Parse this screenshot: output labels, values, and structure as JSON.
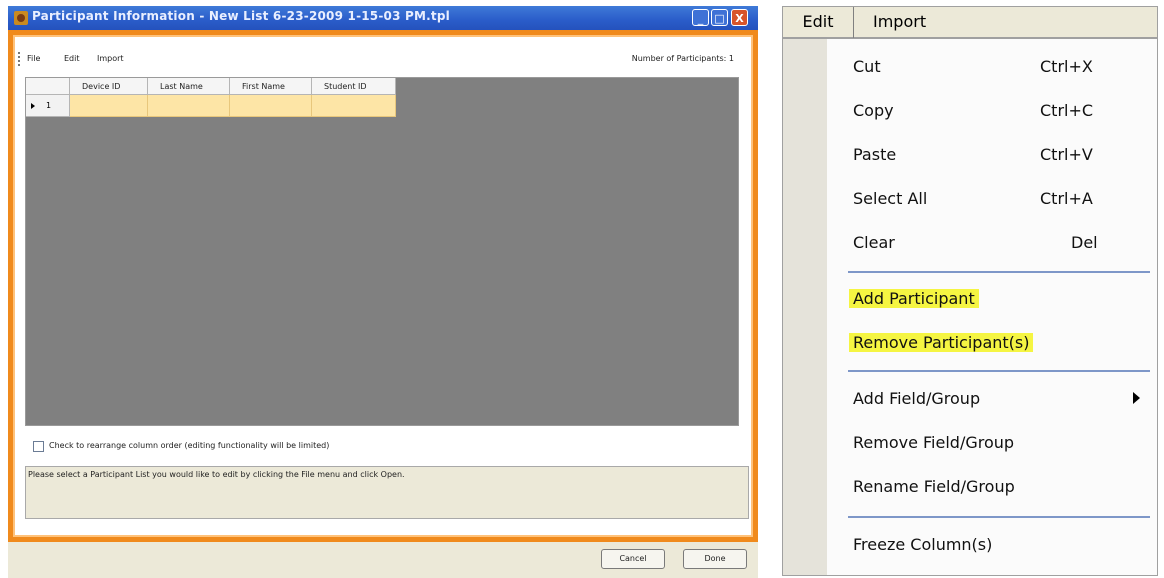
{
  "window": {
    "title": "Participant Information - New List 6-23-2009 1-15-03 PM.tpl",
    "controls": {
      "minimize": "_",
      "maximize": "□",
      "close": "X"
    },
    "menu": [
      "File",
      "Edit",
      "Import"
    ],
    "participant_count": "Number of Participants: 1",
    "grid": {
      "columns": [
        "Device ID",
        "Last Name",
        "First Name",
        "Student ID"
      ],
      "rows": [
        {
          "number": "1",
          "cells": [
            "",
            "",
            "",
            ""
          ]
        }
      ]
    },
    "rearrange_label": "Check to rearrange column order (editing functionality will be limited)",
    "status_message": "Please select a Participant List you would like to edit by clicking the File menu and click Open.",
    "buttons": {
      "cancel": "Cancel",
      "done": "Done"
    }
  },
  "edit_menu": {
    "menubar": [
      "Edit",
      "Import"
    ],
    "groups": [
      [
        {
          "label": "Cut",
          "shortcut": "Ctrl+X"
        },
        {
          "label": "Copy",
          "shortcut": "Ctrl+C"
        },
        {
          "label": "Paste",
          "shortcut": "Ctrl+V"
        },
        {
          "label": "Select All",
          "shortcut": "Ctrl+A"
        },
        {
          "label": "Clear",
          "shortcut": "Del"
        }
      ],
      [
        {
          "label": "Add Participant",
          "highlighted": true
        },
        {
          "label": "Remove Participant(s)",
          "highlighted": true
        }
      ],
      [
        {
          "label": "Add Field/Group",
          "submenu": true
        },
        {
          "label": "Remove Field/Group"
        },
        {
          "label": "Rename Field/Group"
        }
      ],
      [
        {
          "label": "Freeze Column(s)"
        }
      ]
    ]
  },
  "colors": {
    "frame_orange": "#f08a1c",
    "grid_gray": "#808080",
    "row_yellow": "#fde5a6",
    "highlight": "#f5f542",
    "separator": "#7e97c8"
  }
}
